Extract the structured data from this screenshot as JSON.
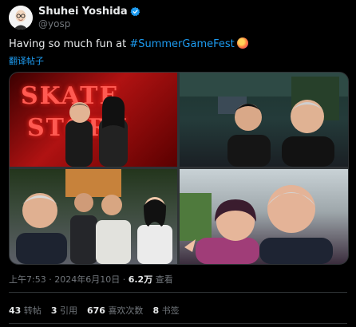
{
  "author": {
    "name": "Shuhei Yoshida",
    "handle": "@yosp",
    "verified_color": "#1d9bf0"
  },
  "tweet": {
    "text_prefix": "Having so much fun at ",
    "hashtag": "#SummerGameFest",
    "translate_label": "翻译帖子"
  },
  "media": {
    "photos": [
      {
        "label": "photo-1",
        "sign_line1": "SKATE",
        "sign_line2": "STORY"
      },
      {
        "label": "photo-2"
      },
      {
        "label": "photo-3"
      },
      {
        "label": "photo-4"
      }
    ]
  },
  "meta": {
    "time": "上午7:53",
    "separator": "·",
    "date": "2024年6月10日",
    "views_count": "6.2万",
    "views_label": "查看"
  },
  "stats": [
    {
      "count": "43",
      "label": "转帖"
    },
    {
      "count": "3",
      "label": "引用"
    },
    {
      "count": "676",
      "label": "喜欢次数"
    },
    {
      "count": "8",
      "label": "书签"
    }
  ],
  "colors": {
    "background": "#000000",
    "text": "#e7e9ea",
    "muted": "#71767b",
    "accent": "#1d9bf0",
    "border": "#2f3336"
  }
}
